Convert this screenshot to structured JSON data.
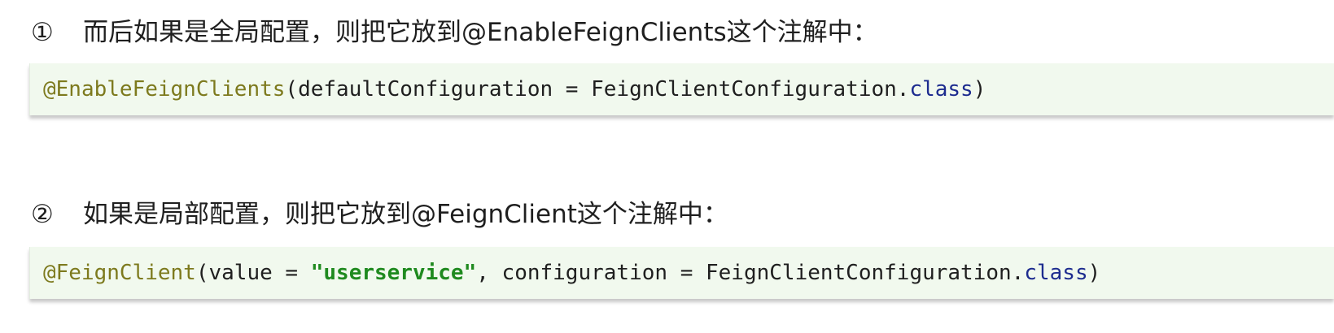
{
  "sections": [
    {
      "marker": "①",
      "text": "而后如果是全局配置，则把它放到@EnableFeignClients这个注解中：",
      "code": {
        "annotation": "@EnableFeignClients",
        "open_paren": "(",
        "part1": "defaultConfiguration = FeignClientConfiguration.",
        "keyword": "class",
        "close_paren": ")"
      }
    },
    {
      "marker": "②",
      "text": "如果是局部配置，则把它放到@FeignClient这个注解中：",
      "code": {
        "annotation": "@FeignClient",
        "open_paren": "(",
        "part1": "value = ",
        "string": "\"userservice\"",
        "part2": ", configuration = FeignClientConfiguration.",
        "keyword": "class",
        "close_paren": ")"
      }
    }
  ],
  "colors": {
    "code_background": "#f1f9ee",
    "annotation": "#7d7a1e",
    "keyword": "#1d2c8f",
    "string": "#1f8a1f",
    "text": "#1f1f1f"
  }
}
